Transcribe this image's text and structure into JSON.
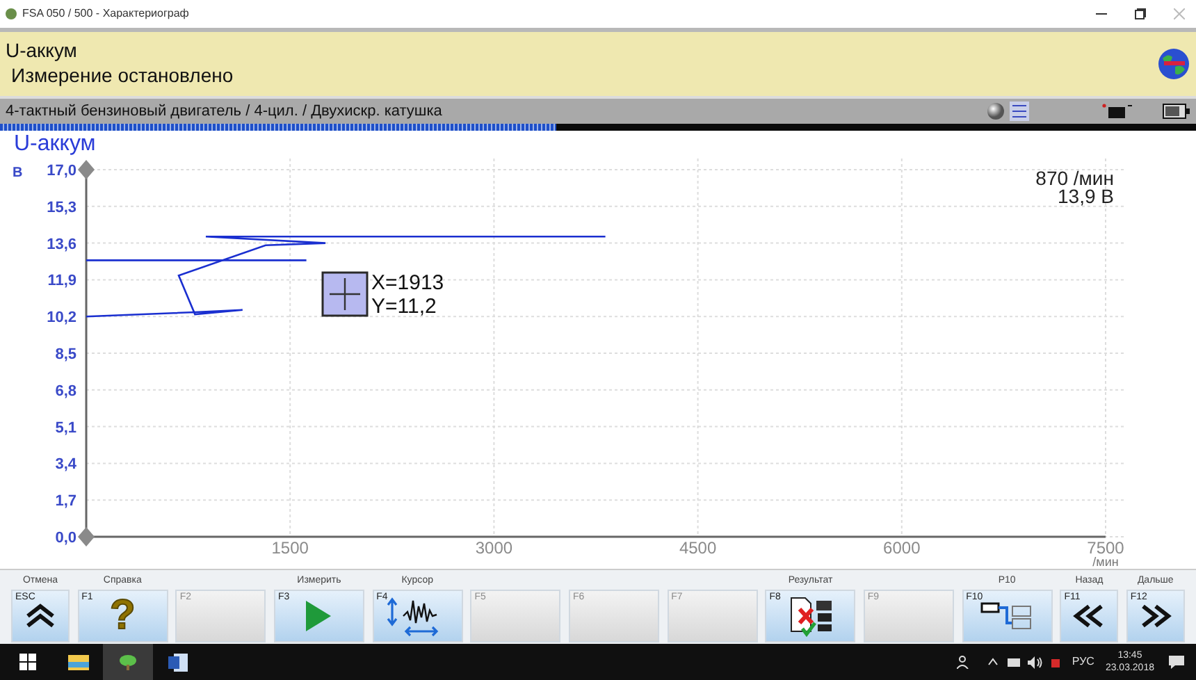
{
  "window": {
    "title": "FSA 050 / 500 - Характериограф"
  },
  "header": {
    "title": "U-аккум",
    "status": "Измерение остановлено"
  },
  "info_bar": {
    "text": "4-тактный бензиновый двигатель /  4-цил. / Двухискр. катушка"
  },
  "progress": {
    "level": 0.465
  },
  "chart_panel": {
    "readout": [
      "870 /мин",
      "13,9 В"
    ],
    "cursor": {
      "x": "X=1913",
      "y": "Y=11,2"
    },
    "chart_data": {
      "type": "line",
      "title": "U-аккум",
      "xlabel": "/мин",
      "ylabel": "В",
      "x": [
        0,
        800,
        1150,
        800,
        680,
        1320,
        1760,
        880,
        3820,
        0,
        1620
      ],
      "series": [
        {
          "color": "#1a2fd0",
          "values": [
            10.2,
            10.4,
            10.5,
            10.3,
            12.1,
            13.5,
            13.6,
            13.9,
            13.9,
            null,
            null
          ]
        },
        {
          "color": "#1a2fd0",
          "values": [
            null,
            null,
            null,
            null,
            null,
            null,
            null,
            null,
            null,
            12.8,
            12.8
          ]
        }
      ],
      "grid": true,
      "xlim": [
        0,
        7500
      ],
      "ylim": [
        0,
        17
      ],
      "xticks": [
        1500,
        3000,
        4500,
        6000,
        7500
      ],
      "yticks": [
        {
          "value": 0,
          "label": "0,0"
        },
        {
          "value": 1.7,
          "label": "1,7"
        },
        {
          "value": 3.4,
          "label": "3,4"
        },
        {
          "value": 5.1,
          "label": "5,1"
        },
        {
          "value": 6.8,
          "label": "6,8"
        },
        {
          "value": 8.5,
          "label": "8,5"
        },
        {
          "value": 10.2,
          "label": "10,2"
        },
        {
          "value": 11.9,
          "label": "11,9"
        },
        {
          "value": 13.6,
          "label": "13,6"
        },
        {
          "value": 15.3,
          "label": "15,3"
        },
        {
          "value": 17,
          "label": "17,0"
        }
      ]
    }
  },
  "function_keys": [
    {
      "caption": "Отмена",
      "key": "ESC",
      "kind": "up",
      "disabled": false
    },
    {
      "caption": "Справка",
      "key": "F1",
      "kind": "help",
      "glyph": "?",
      "disabled": false
    },
    {
      "key": "F2",
      "kind": "blank",
      "disabled": true
    },
    {
      "caption": "Измерить",
      "key": "F3",
      "kind": "play",
      "disabled": false
    },
    {
      "caption": "Курсор",
      "key": "F4",
      "kind": "cursor",
      "disabled": false
    },
    {
      "key": "F5",
      "kind": "blank",
      "disabled": true
    },
    {
      "key": "F6",
      "kind": "blank",
      "disabled": true
    },
    {
      "key": "F7",
      "kind": "blank",
      "disabled": true
    },
    {
      "caption": "Результат",
      "key": "F8",
      "kind": "result",
      "disabled": false
    },
    {
      "key": "F9",
      "kind": "blank",
      "disabled": true
    },
    {
      "caption": "P10",
      "key": "F10",
      "kind": "p10",
      "disabled": false
    },
    {
      "caption": "Назад",
      "key": "F11",
      "kind": "back",
      "disabled": false
    },
    {
      "caption": "Дальше",
      "key": "F12",
      "kind": "forward",
      "disabled": false
    }
  ],
  "taskbar": {
    "apps": [
      {
        "kind": "start",
        "selected": false
      },
      {
        "kind": "explorer",
        "selected": false
      },
      {
        "kind": "app",
        "selected": true
      },
      {
        "kind": "word",
        "selected": false
      }
    ],
    "language": "РУС",
    "time": "13:45",
    "date": "23.03.2018"
  }
}
